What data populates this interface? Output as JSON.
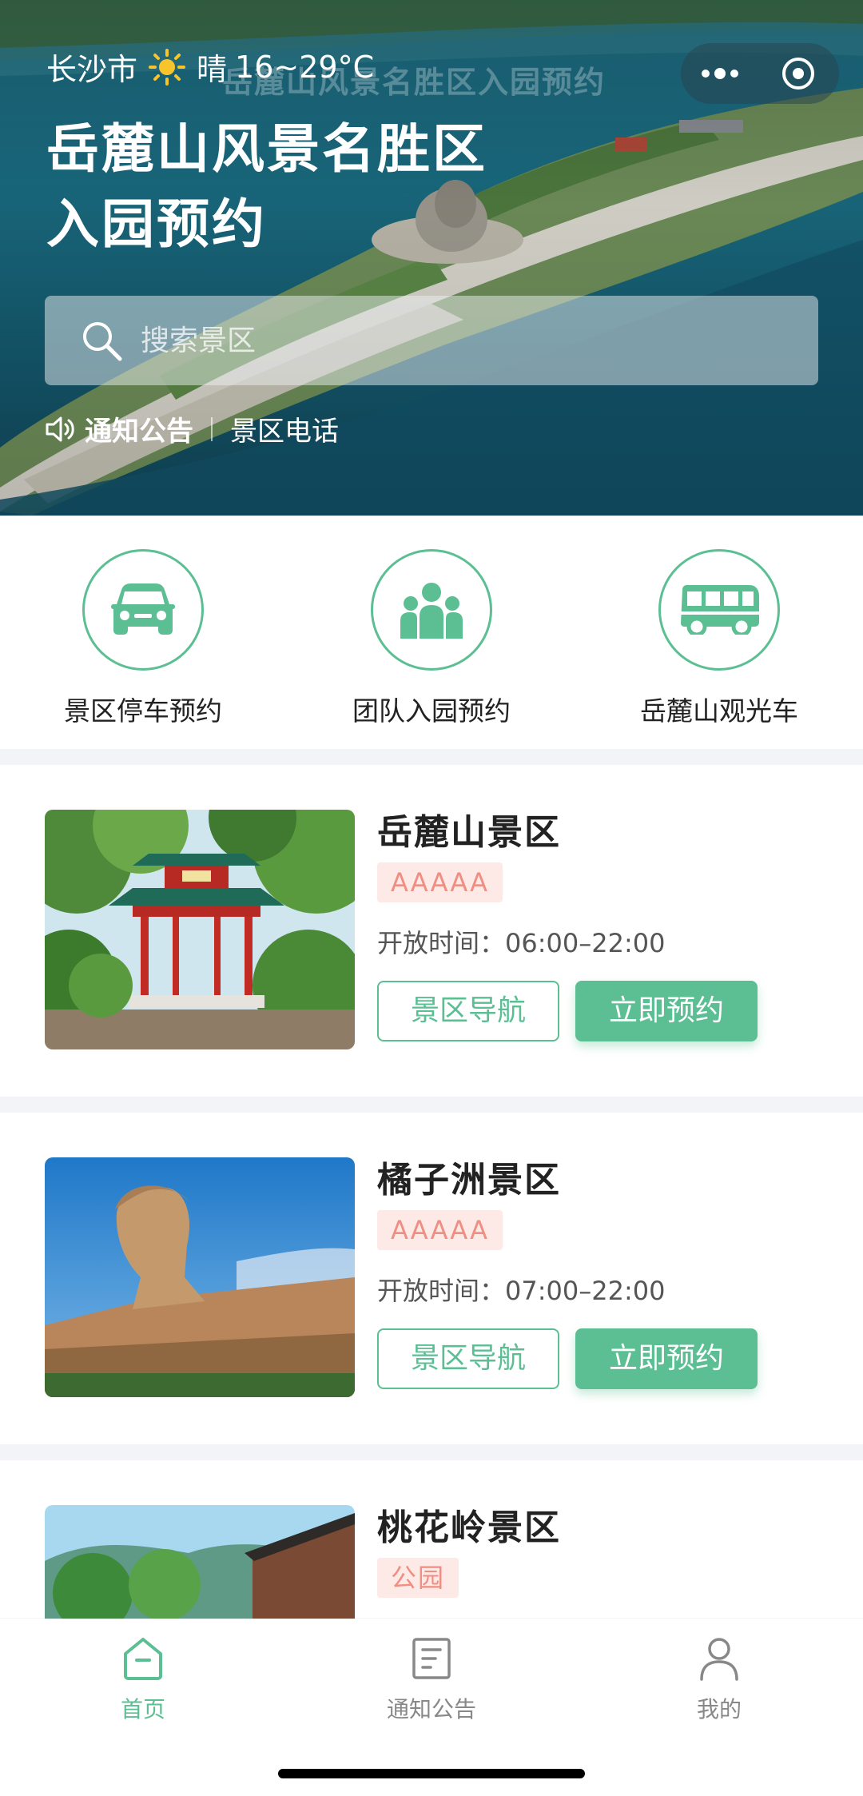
{
  "status": {
    "city": "长沙市",
    "weather": "晴",
    "temp": "16~29°C",
    "ghost_title": "岳麓山风景名胜区入园预约"
  },
  "hero": {
    "title_line1": "岳麓山风景名胜区",
    "title_line2": "入园预约",
    "search_placeholder": "搜索景区",
    "notice_label": "通知公告",
    "phone_label": "景区电话"
  },
  "services": [
    {
      "label": "景区停车预约",
      "icon": "car-icon"
    },
    {
      "label": "团队入园预约",
      "icon": "group-icon"
    },
    {
      "label": "岳麓山观光车",
      "icon": "bus-icon"
    }
  ],
  "scenic_spots": [
    {
      "name": "岳麓山景区",
      "tag": "AAAAA",
      "hours_label": "开放时间：",
      "hours": "06:00–22:00",
      "nav_label": "景区导航",
      "book_label": "立即预约"
    },
    {
      "name": "橘子洲景区",
      "tag": "AAAAA",
      "hours_label": "开放时间：",
      "hours": "07:00–22:00",
      "nav_label": "景区导航",
      "book_label": "立即预约"
    },
    {
      "name": "桃花岭景区",
      "tag": "公园"
    }
  ],
  "tabbar": [
    {
      "label": "首页",
      "icon": "home-icon",
      "active": true
    },
    {
      "label": "通知公告",
      "icon": "notice-icon",
      "active": false
    },
    {
      "label": "我的",
      "icon": "user-icon",
      "active": false
    }
  ],
  "colors": {
    "accent": "#5bbf93",
    "tag_bg": "#fde9e6",
    "tag_text": "#ef8f83",
    "separator": "#f3f4f7"
  }
}
